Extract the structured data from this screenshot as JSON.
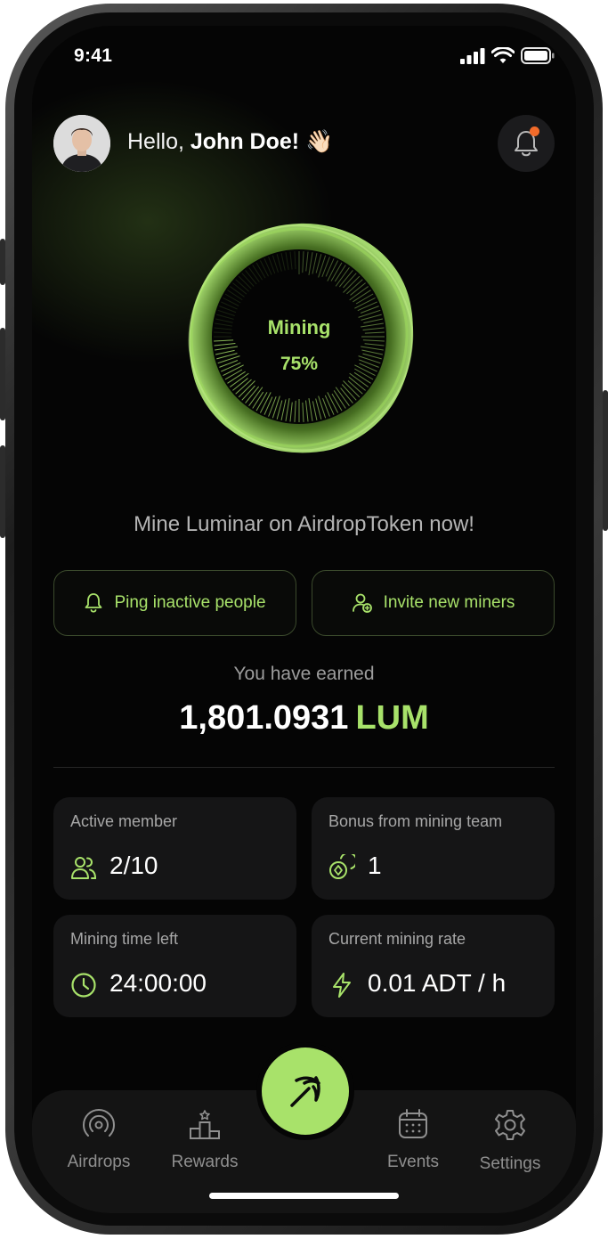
{
  "status_bar": {
    "time": "9:41"
  },
  "header": {
    "greeting_prefix": "Hello, ",
    "user_name": "John Doe!",
    "wave_emoji": "👋🏻",
    "notification_icon": "bell-icon",
    "has_unread": true
  },
  "mining": {
    "label": "Mining",
    "progress_text": "75%",
    "progress": 0.75
  },
  "tagline": "Mine Luminar on AirdropToken now!",
  "actions": [
    {
      "label": "Ping inactive people",
      "icon": "bell-icon"
    },
    {
      "label": "Invite new miners",
      "icon": "user-add-icon"
    }
  ],
  "earnings": {
    "label": "You have earned",
    "amount": "1,801.0931",
    "unit": "LUM"
  },
  "stats": [
    {
      "label": "Active member",
      "value": "2/10",
      "icon": "users-icon"
    },
    {
      "label": "Bonus from mining team",
      "value": "1",
      "icon": "coins-icon"
    },
    {
      "label": "Mining time left",
      "value": "24:00:00",
      "icon": "clock-icon"
    },
    {
      "label": "Current mining rate",
      "value": "0.01 ADT / h",
      "icon": "lightning-icon"
    }
  ],
  "tabbar": {
    "items": [
      {
        "label": "Airdrops",
        "icon": "airdrop-icon"
      },
      {
        "label": "Rewards",
        "icon": "podium-icon"
      },
      {
        "label": "Events",
        "icon": "calendar-icon"
      },
      {
        "label": "Settings",
        "icon": "gear-icon"
      }
    ],
    "center_action_icon": "pickaxe-icon"
  },
  "colors": {
    "accent": "#a8e26a",
    "background": "#050505",
    "card": "#151516",
    "notification_dot": "#f26b2a"
  }
}
